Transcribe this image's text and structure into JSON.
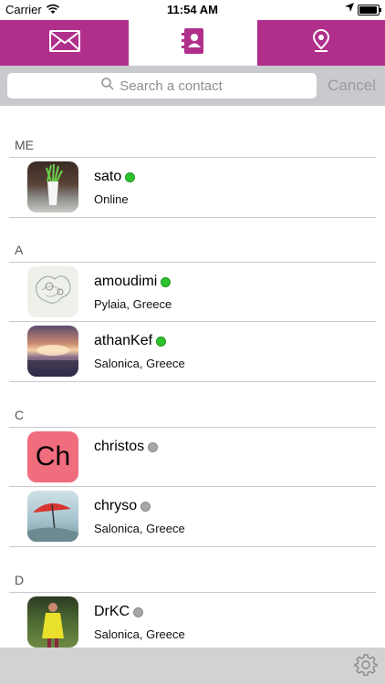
{
  "statusbar": {
    "carrier": "Carrier",
    "time": "11:54 AM"
  },
  "tabs": [
    {
      "name": "messages",
      "icon": "envelope-icon"
    },
    {
      "name": "contacts",
      "icon": "address-book-icon",
      "selected": true
    },
    {
      "name": "location",
      "icon": "map-pin-icon"
    }
  ],
  "search": {
    "placeholder": "Search a contact",
    "cancel_label": "Cancel"
  },
  "sections": {
    "me": "ME",
    "a": "A",
    "c": "C",
    "d": "D"
  },
  "contacts": {
    "sato": {
      "name": "sato",
      "status": "Online",
      "online": true
    },
    "amoudimi": {
      "name": "amoudimi",
      "location": "Pylaia, Greece",
      "online": true
    },
    "athankef": {
      "name": "athanKef",
      "location": "Salonica, Greece",
      "online": true
    },
    "christos": {
      "name": "christos",
      "initials": "Ch",
      "online": false
    },
    "chryso": {
      "name": "chryso",
      "location": "Salonica, Greece",
      "online": false
    },
    "drkc": {
      "name": "DrKC",
      "location": "Salonica, Greece",
      "online": false
    }
  },
  "colors": {
    "accent": "#b02f8b",
    "online": "#2ec12e",
    "offline": "#a7a7a7",
    "initials_bg": "#f06d7e"
  }
}
